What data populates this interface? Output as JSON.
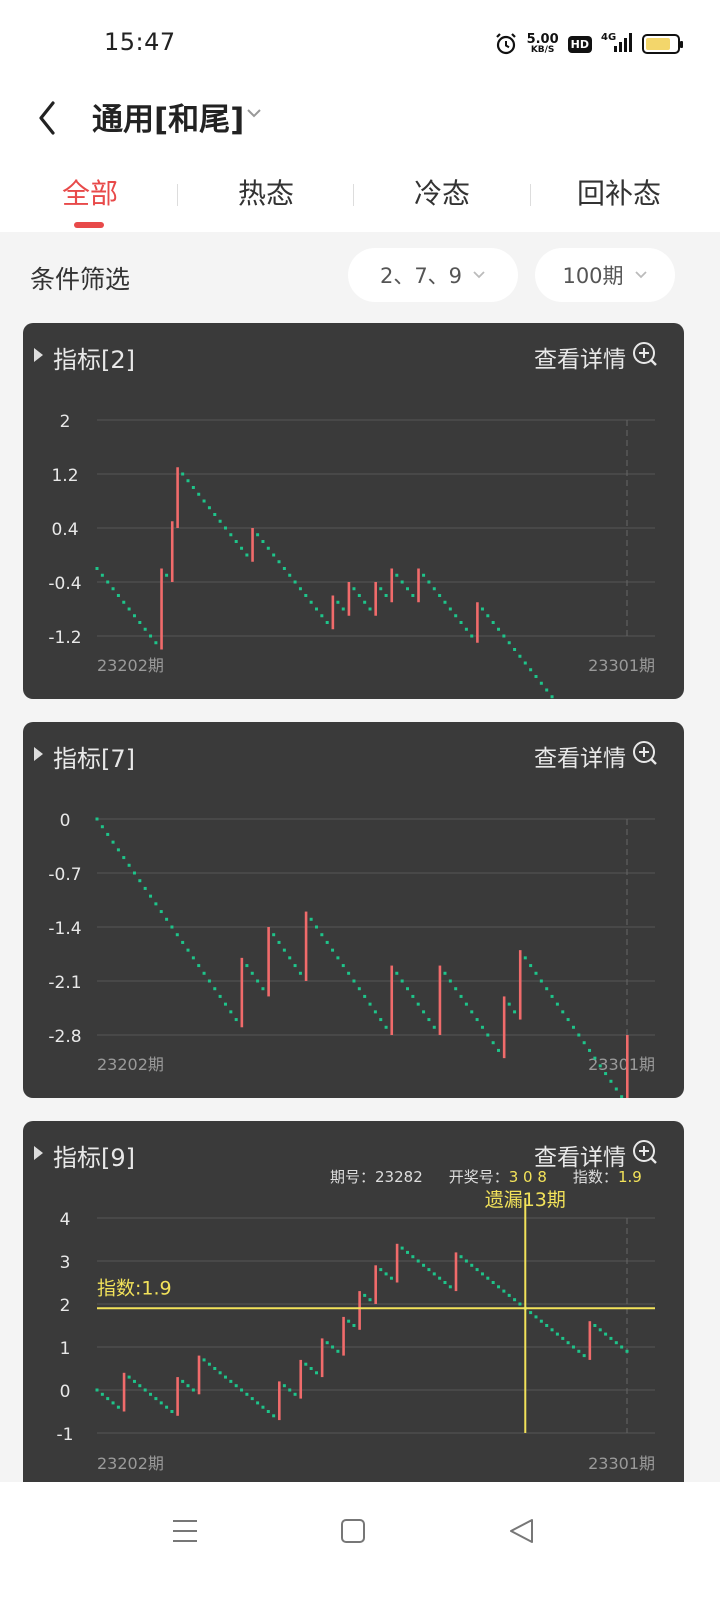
{
  "status_bar": {
    "time": "15:47",
    "net_speed_value": "5.00",
    "net_speed_unit": "KB/S",
    "hd": "HD",
    "network": "4G"
  },
  "header": {
    "title": "通用[和尾]"
  },
  "tabs": [
    {
      "label": "全部",
      "active": true
    },
    {
      "label": "热态",
      "active": false
    },
    {
      "label": "冷态",
      "active": false
    },
    {
      "label": "回补态",
      "active": false
    }
  ],
  "filter": {
    "label": "条件筛选",
    "numbers_value": "2、7、9",
    "period_value": "100期"
  },
  "colors": {
    "accent": "#e84a4a",
    "up": "#f06b6b",
    "down": "#1ec48a",
    "highlight": "#f2e25a",
    "card_bg": "#3a3a3a"
  },
  "cards": [
    {
      "title": "指标[2]",
      "detail_label": "查看详情",
      "chart_data": {
        "type": "line",
        "x_start_label": "23202期",
        "x_end_label": "23301期",
        "y_ticks": [
          "2",
          "1.2",
          "0.4",
          "-0.4",
          "-1.2"
        ],
        "ylim": [
          -1.2,
          2.0
        ],
        "periods": 100,
        "step_down": 0.1,
        "start": -0.2,
        "jumps": [
          [
            12,
            1.2
          ],
          [
            14,
            0.9
          ],
          [
            15,
            0.9
          ],
          [
            29,
            0.5
          ],
          [
            44,
            0.5
          ],
          [
            47,
            0.5
          ],
          [
            52,
            0.5
          ],
          [
            55,
            0.5
          ],
          [
            60,
            0.5
          ],
          [
            71,
            0.6
          ]
        ]
      }
    },
    {
      "title": "指标[7]",
      "detail_label": "查看详情",
      "chart_data": {
        "type": "line",
        "x_start_label": "23202期",
        "x_end_label": "23301期",
        "y_ticks": [
          "0",
          "-0.7",
          "-1.4",
          "-2.1",
          "-2.8"
        ],
        "ylim": [
          -2.8,
          0.0
        ],
        "periods": 100,
        "step_down": 0.1,
        "start": 0.0,
        "jumps": [
          [
            27,
            0.9
          ],
          [
            32,
            0.9
          ],
          [
            39,
            0.9
          ],
          [
            55,
            0.9
          ],
          [
            64,
            0.9
          ],
          [
            76,
            0.8
          ],
          [
            79,
            0.9
          ],
          [
            99,
            0.9
          ]
        ]
      }
    },
    {
      "title": "指标[9]",
      "detail_label": "查看详情",
      "tooltip": {
        "period_label": "期号：",
        "period_value": "23282",
        "draw_label": "开奖号：",
        "draw_value": "3 0 8",
        "index_label": "指数：",
        "index_value": "1.9",
        "missed_text": "遗漏13期",
        "index_line_label": "指数:1.9"
      },
      "chart_data": {
        "type": "line",
        "x_start_label": "23202期",
        "x_end_label": "23301期",
        "y_ticks": [
          "4",
          "3",
          "2",
          "1",
          "0",
          "-1"
        ],
        "ylim": [
          -1,
          4
        ],
        "periods": 100,
        "step_down": 0.1,
        "start": 0.0,
        "jumps": [
          [
            5,
            0.9
          ],
          [
            15,
            0.9
          ],
          [
            19,
            0.9
          ],
          [
            34,
            0.9
          ],
          [
            38,
            0.9
          ],
          [
            42,
            0.9
          ],
          [
            46,
            0.9
          ],
          [
            49,
            0.9
          ],
          [
            52,
            0.9
          ],
          [
            56,
            0.9
          ],
          [
            67,
            0.9
          ],
          [
            92,
            0.9
          ]
        ],
        "crosshair_index": 80,
        "crosshair_value": 1.9
      }
    }
  ]
}
